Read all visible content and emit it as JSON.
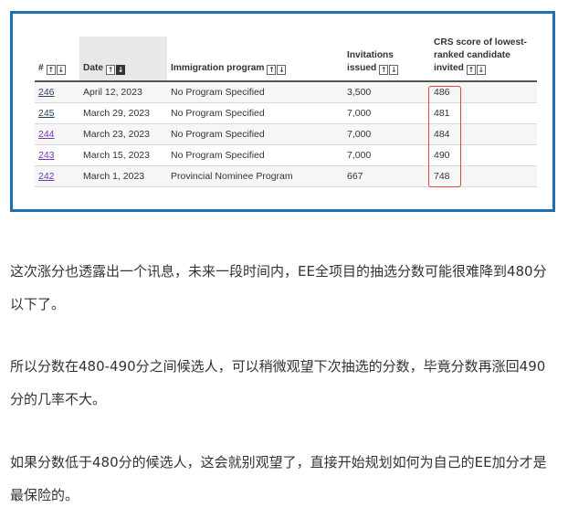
{
  "table": {
    "headers": {
      "num": "#",
      "date": "Date",
      "program": "Immigration program",
      "invitations_line1": "Invitations",
      "invitations_line2": "issued",
      "crs_line1": "CRS score of lowest-",
      "crs_line2": "ranked candidate",
      "crs_line3": "invited"
    },
    "sort_icons": {
      "up": "⇧",
      "down": "⇩",
      "up_solid": "↑",
      "down_solid": "↓"
    },
    "rows": [
      {
        "num": "246",
        "date": "April 12, 2023",
        "program": "No Program Specified",
        "invitations": "3,500",
        "crs": "486",
        "visited": false
      },
      {
        "num": "245",
        "date": "March 29, 2023",
        "program": "No Program Specified",
        "invitations": "7,000",
        "crs": "481",
        "visited": false
      },
      {
        "num": "244",
        "date": "March 23, 2023",
        "program": "No Program Specified",
        "invitations": "7,000",
        "crs": "484",
        "visited": true
      },
      {
        "num": "243",
        "date": "March 15, 2023",
        "program": "No Program Specified",
        "invitations": "7,000",
        "crs": "490",
        "visited": true
      },
      {
        "num": "242",
        "date": "March 1, 2023",
        "program": "Provincial Nominee Program",
        "invitations": "667",
        "crs": "748",
        "visited": true
      }
    ]
  },
  "article": {
    "p1": "这次涨分也透露出一个讯息，未来一段时间内，EE全项目的抽选分数可能很难降到480分以下了。",
    "p2": "所以分数在480-490分之间候选人，可以稍微观望下次抽选的分数，毕竟分数再涨回490分的几率不大。",
    "p3": "如果分数低于480分的候选人，这会就别观望了，直接开始规划如何为自己的EE加分才是最保险的。"
  },
  "colors": {
    "frame": "#1f6fb2",
    "highlight": "#e0463a",
    "link": "#284162",
    "visited": "#7834bc"
  }
}
